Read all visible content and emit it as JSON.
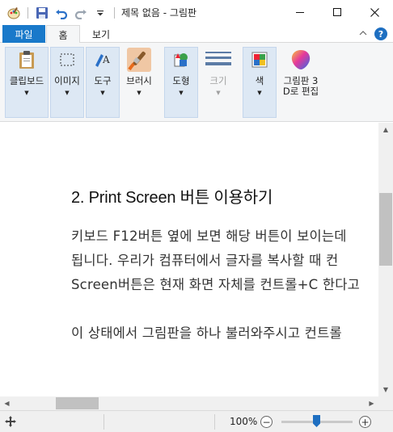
{
  "window": {
    "title": "제목 없음 - 그림판",
    "controls": [
      "minimize",
      "maximize",
      "close"
    ]
  },
  "quick_access": [
    "app-icon",
    "save-icon",
    "undo-icon",
    "redo-icon",
    "customize-dropdown-icon"
  ],
  "tabs": [
    {
      "label": "파일",
      "active": false
    },
    {
      "label": "홈",
      "active": true
    },
    {
      "label": "보기",
      "active": false
    }
  ],
  "ribbon": {
    "clipboard": "클립보드",
    "image": "이미지",
    "tools": "도구",
    "brushes": "브러시",
    "shapes": "도형",
    "size": "크기",
    "colors": "색",
    "paint3d_line1": "그림판 3",
    "paint3d_line2": "D로 편집"
  },
  "canvas": {
    "heading": "2. Print Screen 버튼 이용하기",
    "lines": [
      "키보드 F12버튼 옆에 보면 해당 버튼이 보이는데",
      "됩니다. 우리가 컴퓨터에서 글자를 복사할 때 컨",
      "Screen버튼은 현재 화면 자체를 컨트롤+C 한다고",
      "이 상태에서 그림판을 하나 불러와주시고 컨트롤"
    ]
  },
  "status": {
    "zoom_label": "100%",
    "zoom_percent": 100
  },
  "colors": {
    "file_tab": "#1979ca",
    "accent": "#1e6fc1",
    "group_bg": "#dde8f4"
  }
}
